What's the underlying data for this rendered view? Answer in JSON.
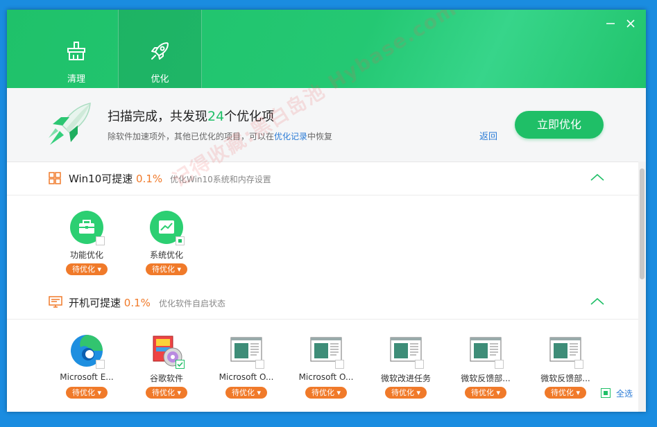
{
  "tabs": [
    {
      "label": "清理",
      "icon": "broom-icon"
    },
    {
      "label": "优化",
      "icon": "rocket-icon"
    }
  ],
  "summary": {
    "title_prefix": "扫描完成，共发现",
    "count": "24",
    "title_suffix": "个优化项",
    "sub_prefix": "除软件加速项外，其他已优化的项目，可以在",
    "sub_link": "优化记录",
    "sub_suffix": "中恢复",
    "back_label": "返回",
    "optimize_label": "立即优化"
  },
  "watermark": "记得收藏:黑白岛池 Hybase.com",
  "sections": [
    {
      "title": "Win10可提速",
      "pct": "0.1%",
      "desc": "优化Win10系统和内存设置"
    },
    {
      "title": "开机可提速",
      "pct": "0.1%",
      "desc": "优化软件自启状态"
    }
  ],
  "win10_items": [
    {
      "name": "功能优化",
      "badge": "待优化",
      "checked": false
    },
    {
      "name": "系统优化",
      "badge": "待优化",
      "checked": true
    }
  ],
  "startup_items": [
    {
      "name": "Microsoft E...",
      "badge": "待优化",
      "checked": false
    },
    {
      "name": "谷歌软件",
      "badge": "待优化",
      "checked": true
    },
    {
      "name": "Microsoft O...",
      "badge": "待优化",
      "checked": false
    },
    {
      "name": "Microsoft O...",
      "badge": "待优化",
      "checked": false
    },
    {
      "name": "微软改进任务",
      "badge": "待优化",
      "checked": false
    },
    {
      "name": "微软反馈部...",
      "badge": "待优化",
      "checked": false
    },
    {
      "name": "微软反馈部...",
      "badge": "待优化",
      "checked": false
    }
  ],
  "select_all_label": "全选",
  "colors": {
    "brand_green": "#1fbf67",
    "accent_orange": "#f07a2a",
    "link_blue": "#2a7bd6"
  }
}
